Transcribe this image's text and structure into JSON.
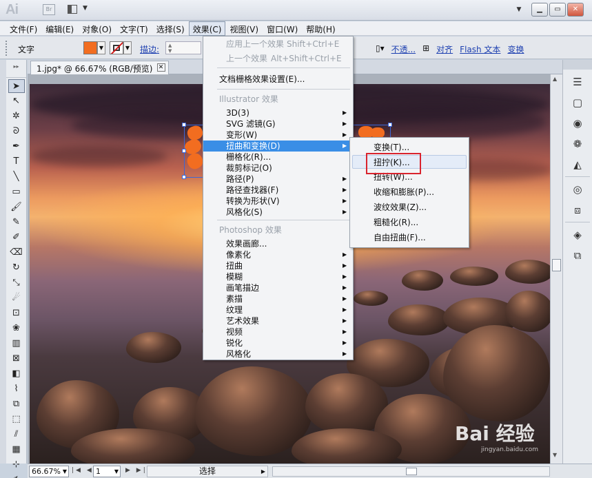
{
  "titlebar": {
    "app_logo": "Ai",
    "bridge_label": "Br",
    "win_minimize": "▁",
    "win_restore": "▭",
    "win_close": "✕"
  },
  "menubar": [
    "文件(F)",
    "编辑(E)",
    "对象(O)",
    "文字(T)",
    "选择(S)",
    "效果(C)",
    "视图(V)",
    "窗口(W)",
    "帮助(H)"
  ],
  "controlbar": {
    "label": "文字",
    "stroke_label": "描边:",
    "opacity_label": "不透...",
    "align_label": "对齐",
    "flash_text_label": "Flash 文本",
    "transform_label": "变换",
    "fill_color": "#f26d20"
  },
  "document": {
    "tab_label": "1.jpg* @ 66.67% (RGB/预览)",
    "tab_close": "✕"
  },
  "effect_menu": {
    "items": [
      {
        "label": "应用上一个效果",
        "shortcut": "Shift+Ctrl+E",
        "disabled": true
      },
      {
        "label": "上一个效果",
        "shortcut": "Alt+Shift+Ctrl+E",
        "disabled": true
      },
      {
        "label": "文档栅格效果设置(E)...",
        "shortcut": "",
        "disabled": false
      },
      {
        "label": "Illustrator 效果",
        "header": true
      },
      {
        "label": "3D(3)",
        "arrow": true
      },
      {
        "label": "SVG 滤镜(G)",
        "arrow": true
      },
      {
        "label": "变形(W)",
        "arrow": true
      },
      {
        "label": "扭曲和变换(D)",
        "arrow": true,
        "highlighted": true
      },
      {
        "label": "栅格化(R)...",
        "arrow": false
      },
      {
        "label": "裁剪标记(O)",
        "arrow": false
      },
      {
        "label": "路径(P)",
        "arrow": true
      },
      {
        "label": "路径查找器(F)",
        "arrow": true
      },
      {
        "label": "转换为形状(V)",
        "arrow": true
      },
      {
        "label": "风格化(S)",
        "arrow": true
      },
      {
        "label": "Photoshop 效果",
        "header": true
      },
      {
        "label": "效果画廊...",
        "arrow": false
      },
      {
        "label": "像素化",
        "arrow": true
      },
      {
        "label": "扭曲",
        "arrow": true
      },
      {
        "label": "模糊",
        "arrow": true
      },
      {
        "label": "画笔描边",
        "arrow": true
      },
      {
        "label": "素描",
        "arrow": true
      },
      {
        "label": "纹理",
        "arrow": true
      },
      {
        "label": "艺术效果",
        "arrow": true
      },
      {
        "label": "视频",
        "arrow": true
      },
      {
        "label": "锐化",
        "arrow": true
      },
      {
        "label": "风格化",
        "arrow": true
      }
    ]
  },
  "distort_submenu": {
    "items": [
      {
        "label": "变换(T)..."
      },
      {
        "label": "扭拧(K)...",
        "hover": true
      },
      {
        "label": "扭转(W)..."
      },
      {
        "label": "收缩和膨胀(P)..."
      },
      {
        "label": "波纹效果(Z)..."
      },
      {
        "label": "粗糙化(R)..."
      },
      {
        "label": "自由扭曲(F)..."
      }
    ]
  },
  "statusbar": {
    "zoom": "66.67%",
    "page": "1",
    "status_text": "选择"
  },
  "watermark": {
    "text": "Bai 经验",
    "sub": "jingyan.baidu.com"
  },
  "accent_color": "#3a8ee6",
  "highlight_box_color": "#d9232d"
}
